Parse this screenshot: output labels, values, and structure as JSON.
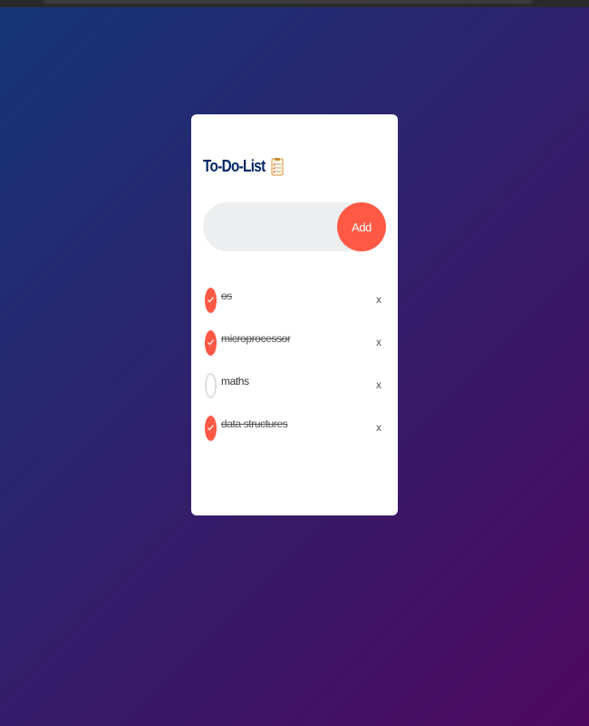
{
  "app": {
    "title": "To-Do-List",
    "title_icon": "checklist-icon"
  },
  "input": {
    "value": "",
    "placeholder": ""
  },
  "add_button": {
    "label": "Add"
  },
  "tasks": [
    {
      "text": "os",
      "completed": true,
      "delete_label": "x"
    },
    {
      "text": "microprocessor",
      "completed": true,
      "delete_label": "x"
    },
    {
      "text": "maths",
      "completed": false,
      "delete_label": "x"
    },
    {
      "text": "data structures",
      "completed": true,
      "delete_label": "x"
    }
  ],
  "colors": {
    "accent": "#ff5945",
    "title": "#002765",
    "gradient_start": "#153677",
    "gradient_end": "#4e085f",
    "input_bg": "#edeef0"
  }
}
